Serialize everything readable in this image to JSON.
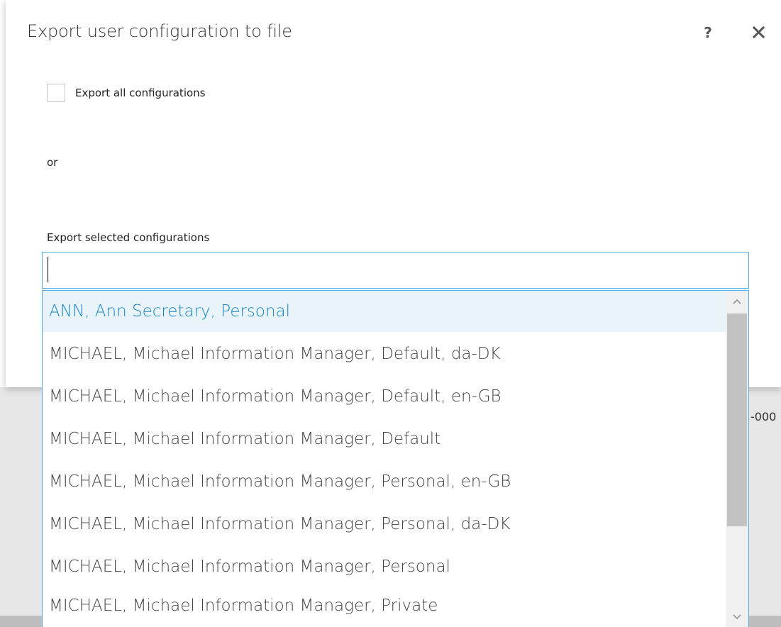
{
  "dialog": {
    "title": "Export user configuration to file",
    "help_label": "?",
    "export_all_label": "Export all configurations",
    "export_all_checked": false,
    "or_label": "or",
    "selected_label": "Export selected configurations",
    "search_value": ""
  },
  "dropdown": {
    "options": [
      "ANN, Ann Secretary, Personal",
      "MICHAEL, Michael Information Manager, Default, da-DK",
      "MICHAEL, Michael Information Manager, Default, en-GB",
      "MICHAEL, Michael Information Manager, Default",
      "MICHAEL, Michael Information Manager, Personal, en-GB",
      "MICHAEL, Michael Information Manager, Personal, da-DK",
      "MICHAEL, Michael Information Manager, Personal",
      "MICHAEL, Michael Information Manager, Private"
    ],
    "highlighted_index": 0
  },
  "background": {
    "peek_text": "-000"
  },
  "icons": {
    "help": "help-icon",
    "close": "close-icon",
    "scroll_up": "chevron-up-icon",
    "scroll_down": "chevron-down-icon"
  },
  "colors": {
    "accent": "#4fb0e0",
    "highlight_bg": "#e8f4f9",
    "highlight_text": "#1a86c8"
  }
}
